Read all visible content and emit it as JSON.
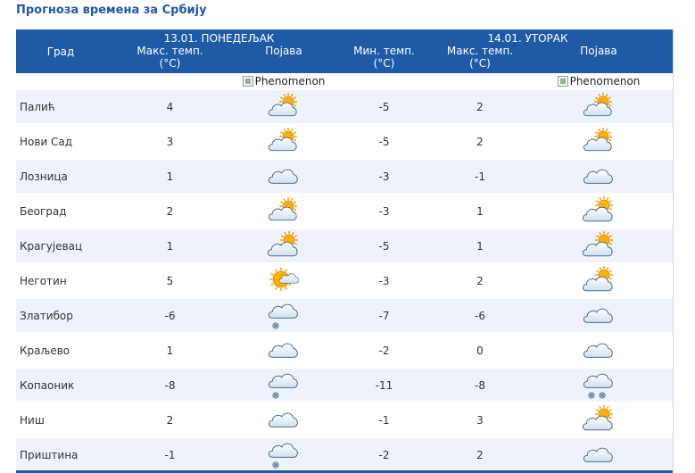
{
  "title": "Прогноза времена за Србију",
  "header": {
    "city": "Град",
    "day1_date": "13.01. ПОНЕДЕЉАК",
    "day2_date": "14.01. УТОРАК",
    "max_temp": "Макс. темп.",
    "min_temp": "Мин. темп.",
    "unit": "(°C)",
    "phenomenon": "Појава",
    "img_alt": "Phenomenon"
  },
  "colors": {
    "header_bg": "#1f5aa6",
    "row_alt": "#eef3fb",
    "title": "#1f5aa6"
  },
  "rows": [
    {
      "city": "Палић",
      "max1": "4",
      "min2": "-5",
      "max2": "2",
      "icon1": "partly-cloudy-sun-icon",
      "icon2": "partly-cloudy-sun-icon"
    },
    {
      "city": "Нови Сад",
      "max1": "3",
      "min2": "-5",
      "max2": "2",
      "icon1": "partly-cloudy-sun-icon",
      "icon2": "partly-cloudy-sun-icon"
    },
    {
      "city": "Лозница",
      "max1": "1",
      "min2": "-3",
      "max2": "-1",
      "icon1": "cloud-icon",
      "icon2": "cloud-icon"
    },
    {
      "city": "Београд",
      "max1": "2",
      "min2": "-3",
      "max2": "1",
      "icon1": "partly-cloudy-sun-icon",
      "icon2": "mostly-cloudy-sun-icon"
    },
    {
      "city": "Крагујевац",
      "max1": "1",
      "min2": "-5",
      "max2": "1",
      "icon1": "mostly-cloudy-sun-icon",
      "icon2": "mostly-cloudy-sun-icon"
    },
    {
      "city": "Неготин",
      "max1": "5",
      "min2": "-3",
      "max2": "2",
      "icon1": "sun-cloud-icon",
      "icon2": "mostly-cloudy-sun-icon"
    },
    {
      "city": "Златибор",
      "max1": "-6",
      "min2": "-7",
      "max2": "-6",
      "icon1": "cloud-snow-icon",
      "icon2": "cloud-icon"
    },
    {
      "city": "Краљево",
      "max1": "1",
      "min2": "-2",
      "max2": "0",
      "icon1": "cloud-icon",
      "icon2": "cloud-icon"
    },
    {
      "city": "Копаоник",
      "max1": "-8",
      "min2": "-11",
      "max2": "-8",
      "icon1": "cloud-snow-icon",
      "icon2": "cloud-heavy-snow-icon"
    },
    {
      "city": "Ниш",
      "max1": "2",
      "min2": "-1",
      "max2": "3",
      "icon1": "cloud-icon",
      "icon2": "mostly-cloudy-sun-icon"
    },
    {
      "city": "Приштина",
      "max1": "-1",
      "min2": "-2",
      "max2": "2",
      "icon1": "cloud-snow-icon",
      "icon2": "cloud-icon"
    }
  ]
}
